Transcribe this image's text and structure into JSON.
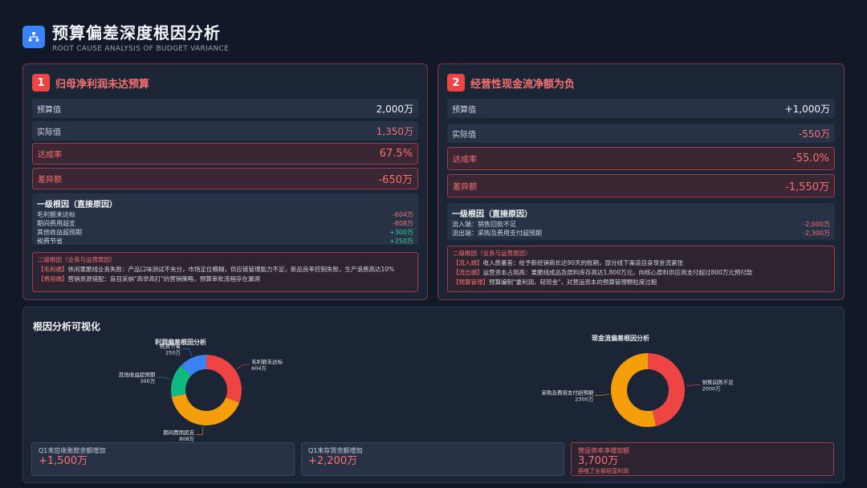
{
  "header": {
    "title": "预算偏差深度根因分析",
    "subtitle": "ROOT CAUSE ANALYSIS OF BUDGET VARIANCE",
    "icon": "org-chart-icon"
  },
  "colors": {
    "accent": "#ef4444",
    "red": "#f87171",
    "green": "#34d399",
    "blue": "#3b82f6",
    "orange": "#f59e0b",
    "teal": "#10b981"
  },
  "panel1": {
    "badge": "1",
    "title": "归母净利润未达预算",
    "rows": [
      {
        "label": "预算值",
        "value": "2,000万"
      },
      {
        "label": "实际值",
        "value": "1,350万"
      },
      {
        "label": "达成率",
        "value": "67.5%"
      },
      {
        "label": "差异额",
        "value": "-650万"
      }
    ],
    "primary": {
      "title": "一级根因（直接原因）",
      "items": [
        {
          "label": "毛利额未达标",
          "value": "-604万"
        },
        {
          "label": "期间费用超支",
          "value": "-808万"
        },
        {
          "label": "其他收益超预期",
          "value": "+300万"
        },
        {
          "label": "税费节省",
          "value": "+250万"
        }
      ]
    },
    "secondary": {
      "title": "二级根因（业务与运营原因）",
      "lines": [
        {
          "tag": "【毛利端】",
          "text": "休闲果脆线业务失败：产品口味测试不充分，市场定位模糊，供应链管理能力不足，新品良率控制失败，生产浪费高达10%"
        },
        {
          "tag": "【费用端】",
          "text": "营销资源错配：盲目采纳\"高举高打\"的营销策略，预算审批流程存在漏洞"
        }
      ]
    }
  },
  "panel2": {
    "badge": "2",
    "title": "经营性现金流净额为负",
    "rows": [
      {
        "label": "预算值",
        "value": "+1,000万"
      },
      {
        "label": "实际值",
        "value": "-550万"
      },
      {
        "label": "达成率",
        "value": "-55.0%"
      },
      {
        "label": "差异额",
        "value": "-1,550万"
      }
    ],
    "primary": {
      "title": "一级根因（直接原因）",
      "items": [
        {
          "label": "流入端：销售回款不足",
          "value": "-2,000万"
        },
        {
          "label": "流出端：采购及费用支付超预期",
          "value": "-2,300万"
        }
      ]
    },
    "secondary": {
      "title": "二级根因（业务与运营原因）",
      "lines": [
        {
          "tag": "【流入端】",
          "text": "收入质量差：给予新经销商长达90天的账期，部分线下渠道自身现金流紧张"
        },
        {
          "tag": "【流出端】",
          "text": "运营资本占用高：果脆线成品及原料库存高达1,800万元，向核心原料供应商支付超过800万元预付款"
        },
        {
          "tag": "【预算管理】",
          "text": "预算编制\"重利润，轻现金\"，对营运资本的预算管理颗粒度过粗"
        }
      ]
    }
  },
  "viz": {
    "title": "根因分析可视化",
    "kpis": [
      {
        "label": "Q1末应收账款余额增加",
        "value": "+1,500万"
      },
      {
        "label": "Q1末存货余额增加",
        "value": "+2,200万"
      },
      {
        "label": "营运资本净增加额",
        "value": "3,700万",
        "note": "吞噬了全部经营利润"
      }
    ]
  },
  "chart_data": [
    {
      "type": "pie",
      "title": "利润偏差根因分析",
      "categories": [
        "毛利额未达标",
        "期间费用超支",
        "其他收益超预期",
        "税费节省"
      ],
      "values": [
        604,
        808,
        300,
        250
      ],
      "value_labels": [
        "604万",
        "808万",
        "300万",
        "250万"
      ],
      "colors": [
        "#ef4444",
        "#f59e0b",
        "#10b981",
        "#3b82f6"
      ]
    },
    {
      "type": "pie",
      "title": "现金流偏差根因分析",
      "categories": [
        "销售回款不足",
        "采购及费用支付超预期"
      ],
      "values": [
        2000,
        2300
      ],
      "value_labels": [
        "2000万",
        "2300万"
      ],
      "colors": [
        "#ef4444",
        "#f59e0b"
      ]
    }
  ]
}
